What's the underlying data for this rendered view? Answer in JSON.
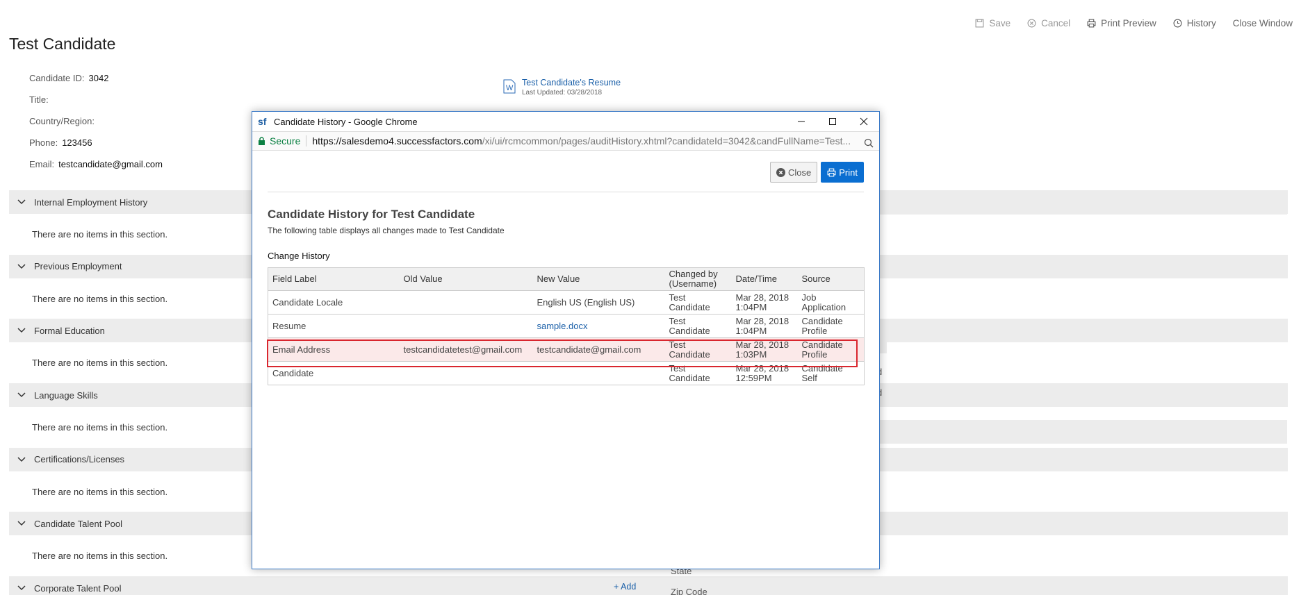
{
  "toolbar": {
    "save": "Save",
    "cancel": "Cancel",
    "print_preview": "Print Preview",
    "history": "History",
    "close_window": "Close Window"
  },
  "page_title": "Test Candidate",
  "info": {
    "candidate_id_label": "Candidate ID:",
    "candidate_id": "3042",
    "title_label": "Title:",
    "country_label": "Country/Region:",
    "phone_label": "Phone:",
    "phone": "123456",
    "email_label": "Email:",
    "email": "testcandidate@gmail.com"
  },
  "resume": {
    "link": "Test Candidate's Resume",
    "updated": "Last Updated: 03/28/2018"
  },
  "sections": [
    {
      "title": "Internal Employment History",
      "empty": "There are no items in this section."
    },
    {
      "title": "Previous Employment",
      "empty": "There are no items in this section."
    },
    {
      "title": "Formal Education",
      "empty": "There are no items in this section."
    },
    {
      "title": "Language Skills",
      "empty": "There are no items in this section."
    },
    {
      "title": "Certifications/Licenses",
      "empty": "There are no items in this section."
    },
    {
      "title": "Candidate Talent Pool",
      "empty": "There are no items in this section."
    },
    {
      "title": "Corporate Talent Pool",
      "add": "+ Add"
    }
  ],
  "right_labels": {
    "state": "State",
    "zip": "Zip Code",
    "frag_d1": "d",
    "frag_d2": "d"
  },
  "popup": {
    "window_title": "Candidate History - Google Chrome",
    "secure": "Secure",
    "url_host": "https://salesdemo4.successfactors.com",
    "url_path": "/xi/ui/rcmcommon/pages/auditHistory.xhtml?candidateId=3042&candFullName=Test...",
    "close_btn": "Close",
    "print_btn": "Print",
    "heading": "Candidate History for Test Candidate",
    "subheading": "The following table displays all changes made to Test Candidate",
    "change_history": "Change History",
    "columns": [
      "Field Label",
      "Old Value",
      "New Value",
      "Changed by (Username)",
      "Date/Time",
      "Source"
    ],
    "rows": [
      {
        "field": "Candidate Locale",
        "old": "",
        "new": "English US (English US)",
        "by": "Test Candidate",
        "date": "Mar 28, 2018 1:04PM",
        "source": "Job Application"
      },
      {
        "field": "Resume",
        "old": "",
        "new": "sample.docx",
        "by": "Test Candidate",
        "date": "Mar 28, 2018 1:04PM",
        "source": "Candidate Profile"
      },
      {
        "field": "Email Address",
        "old": "testcandidatetest@gmail.com",
        "new": "testcandidate@gmail.com",
        "by": "Test Candidate",
        "date": "Mar 28, 2018 1:03PM",
        "source": "Candidate Profile"
      },
      {
        "field": "Candidate",
        "old": "",
        "new": "",
        "by": "Test Candidate",
        "date": "Mar 28, 2018 12:59PM",
        "source": "Candidate Self"
      }
    ]
  }
}
